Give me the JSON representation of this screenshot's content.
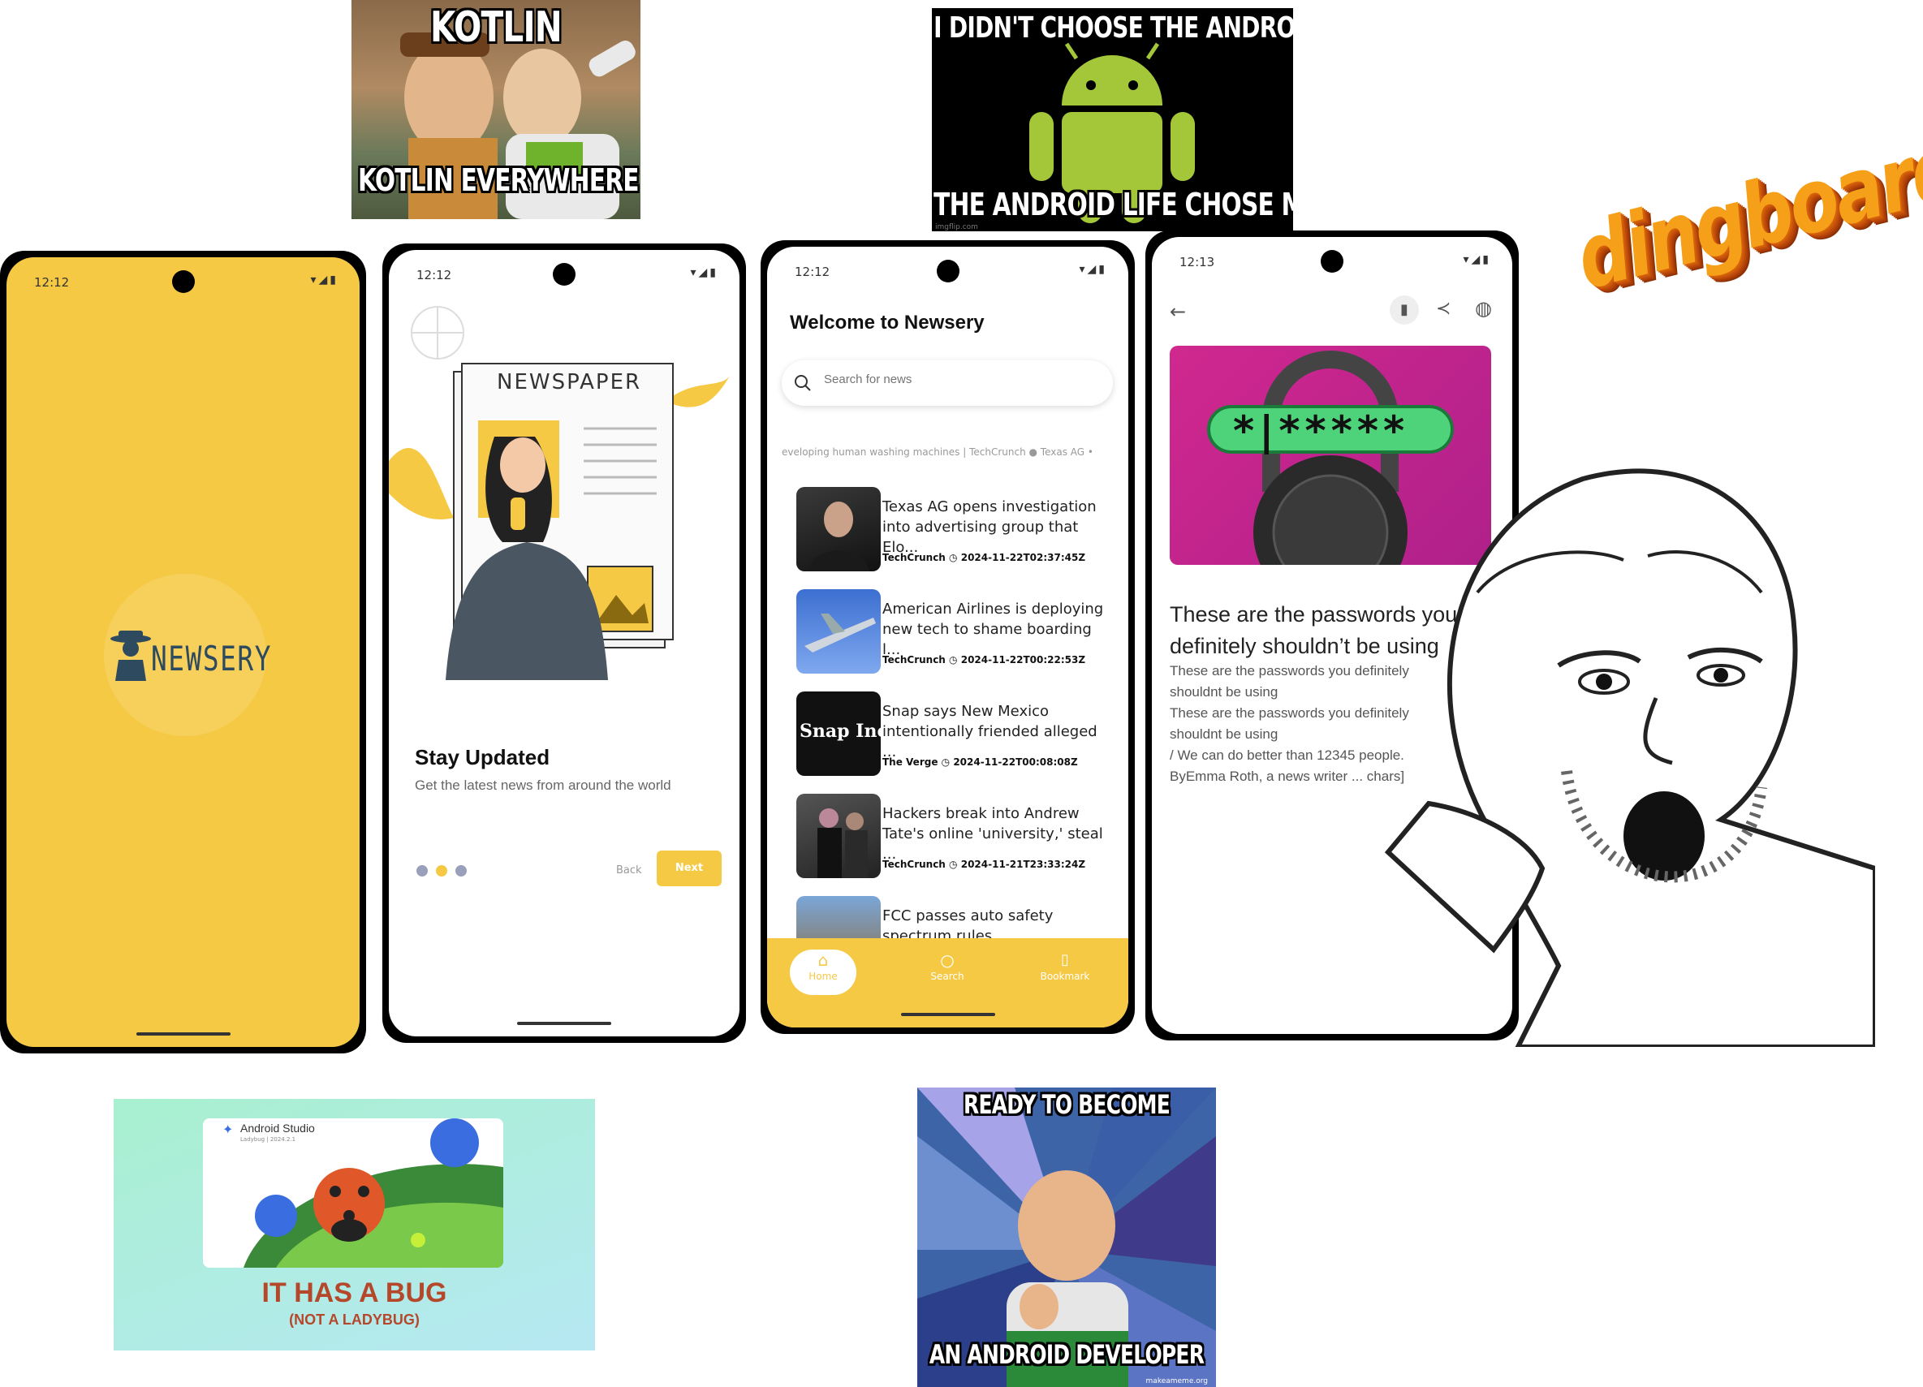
{
  "memes": {
    "kotlin": {
      "top": "KOTLIN",
      "bottom": "KOTLIN EVERYWHERE"
    },
    "android": {
      "top": "I DIDN'T CHOOSE THE ANDROID LIFE",
      "bottom": "THE ANDROID LIFE CHOSE ME",
      "watermark": "imgflip.com"
    },
    "dingboard": "dingboard!",
    "ladybug": {
      "app": "Android Studio",
      "version": "Ladybug | 2024.2.1",
      "headline": "IT HAS A BUG",
      "sub": "(NOT A LADYBUG)"
    },
    "success": {
      "top": "READY TO BECOME",
      "bottom": "AN ANDROID DEVELOPER",
      "watermark": "makeameme.org"
    }
  },
  "phone1": {
    "time": "12:12",
    "logo": "NEWSERY"
  },
  "phone2": {
    "time": "12:12",
    "illustration_label": "NEWSPAPER",
    "heading": "Stay Updated",
    "subheading": "Get the latest news from around the world",
    "back_label": "Back",
    "next_label": "Next"
  },
  "phone3": {
    "time": "12:12",
    "title": "Welcome to Newsery",
    "search_placeholder": "Search for news",
    "ticker": "eveloping human washing machines | TechCrunch  ●  Texas AG •",
    "articles": [
      {
        "title": "Texas AG opens investigation into advertising group that Elo...",
        "source": "TechCrunch",
        "date": "2024-11-22T02:37:45Z"
      },
      {
        "title": "American Airlines is deploying new tech to shame boarding l...",
        "source": "TechCrunch",
        "date": "2024-11-22T00:22:53Z"
      },
      {
        "title": "Snap says New Mexico intentionally friended alleged ...",
        "source": "The Verge",
        "date": "2024-11-22T00:08:08Z"
      },
      {
        "title": "Hackers break into Andrew Tate's online 'university,' steal ...",
        "source": "TechCrunch",
        "date": "2024-11-21T23:33:24Z"
      },
      {
        "title": "FCC passes auto safety spectrum rules",
        "source": "",
        "date": ""
      }
    ],
    "snap_logo": "Snap Inc.",
    "nav": {
      "home": "Home",
      "search": "Search",
      "bookmark": "Bookmark"
    }
  },
  "phone4": {
    "time": "12:13",
    "password_mask": "*|*****",
    "headline": "These are the passwords you definitely shouldn’t be using",
    "body": [
      "These are the passwords you definitely shouldnt be using",
      "These are the passwords you definitely shouldnt be using",
      " / We can do better than 12345 people.",
      "ByEmma Roth, a news writer ... chars]"
    ]
  },
  "colors": {
    "brand_yellow": "#F6C945",
    "magenta": "#C2208F",
    "android_green": "#A4C639"
  }
}
